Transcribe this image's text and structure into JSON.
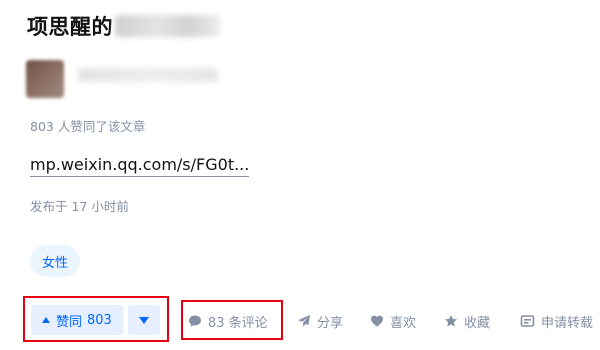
{
  "article": {
    "title": "项思醒的",
    "upvote_note": "803 人赞同了该文章",
    "link_text": "mp.weixin.qq.com/s/FG0t...",
    "publish_time": "发布于 17 小时前",
    "tag": "女性"
  },
  "actions": {
    "vote_label": "赞同",
    "vote_count": "803",
    "comment": "83 条评论",
    "share": "分享",
    "like": "喜欢",
    "favorite": "收藏",
    "repost": "申请转载"
  },
  "colors": {
    "accent": "#0066ff",
    "muted": "#8590a6",
    "highlight_box": "#e60012"
  }
}
